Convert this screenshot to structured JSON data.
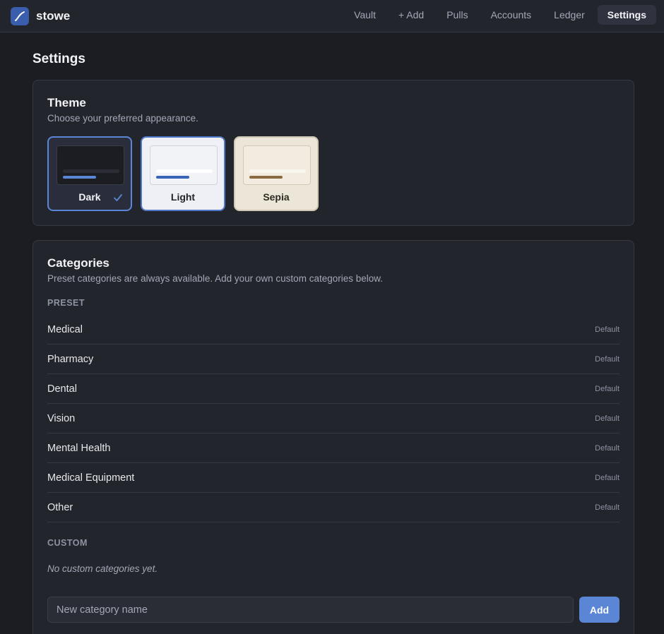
{
  "app": {
    "name": "stowe",
    "logo_icon": "trend-line-icon"
  },
  "nav": {
    "items": [
      "Vault",
      "+ Add",
      "Pulls",
      "Accounts",
      "Ledger",
      "Settings"
    ],
    "active": "Settings"
  },
  "page": {
    "title": "Settings"
  },
  "theme": {
    "title": "Theme",
    "subtitle": "Choose your preferred appearance.",
    "options": [
      {
        "label": "Dark",
        "selected": true
      },
      {
        "label": "Light",
        "selected": false
      },
      {
        "label": "Sepia",
        "selected": false
      }
    ],
    "check_icon": "checkmark-icon"
  },
  "categories": {
    "title": "Categories",
    "subtitle": "Preset categories are always available. Add your own custom categories below.",
    "preset_label": "PRESET",
    "preset": [
      {
        "name": "Medical",
        "badge": "Default"
      },
      {
        "name": "Pharmacy",
        "badge": "Default"
      },
      {
        "name": "Dental",
        "badge": "Default"
      },
      {
        "name": "Vision",
        "badge": "Default"
      },
      {
        "name": "Mental Health",
        "badge": "Default"
      },
      {
        "name": "Medical Equipment",
        "badge": "Default"
      },
      {
        "name": "Other",
        "badge": "Default"
      }
    ],
    "custom_label": "CUSTOM",
    "custom_empty": "No custom categories yet.",
    "new_placeholder": "New category name",
    "new_value": "",
    "add_label": "Add"
  },
  "colors": {
    "accent": "#5b86d6",
    "background": "#1b1d22",
    "card": "#23252c",
    "logo": "#3b5dad"
  }
}
